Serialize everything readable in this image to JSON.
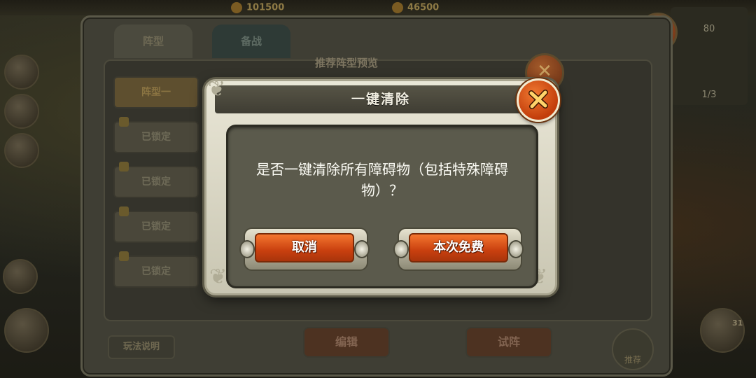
{
  "top": {
    "stat1_value": "101500",
    "stat2_value": "46500"
  },
  "right_panel": {
    "value_a": "80",
    "value_b": "1/3"
  },
  "side_menu": {
    "count_badge": "31"
  },
  "background_window": {
    "tabs": [
      "阵型",
      "备战"
    ],
    "formations": [
      "阵型一",
      "已锁定",
      "已锁定",
      "已锁定",
      "已锁定"
    ],
    "preview_title": "推荐阵型预览",
    "bottom_buttons": {
      "edit": "编辑",
      "trial": "试阵",
      "rules": "玩法说明",
      "recommend": "推荐"
    }
  },
  "dialog": {
    "title": "一键清除",
    "message": "是否一键清除所有障碍物（包括特殊障碍物）？",
    "cancel_label": "取消",
    "confirm_label": "本次免费"
  },
  "colors": {
    "button_orange": "#e05a1c",
    "close_orange": "#e0561a",
    "dialog_body": "#5b5a4c"
  }
}
